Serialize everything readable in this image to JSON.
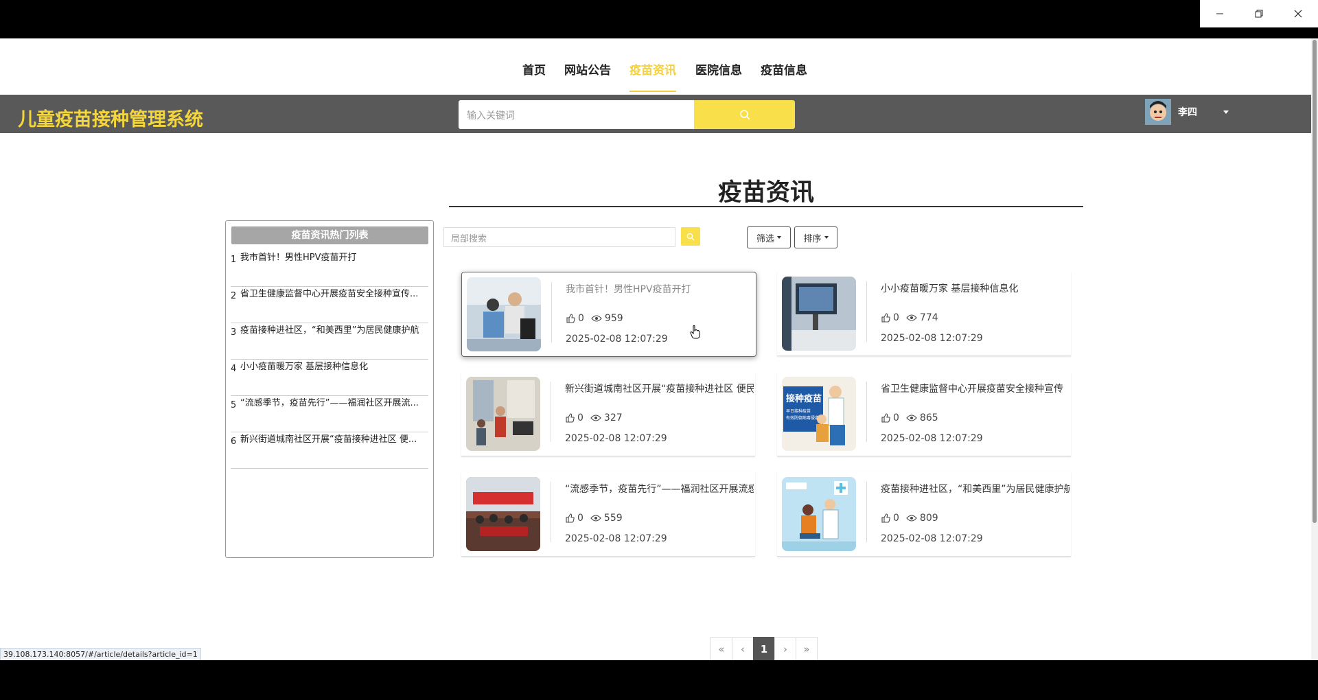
{
  "nav": {
    "items": [
      {
        "label": "首页"
      },
      {
        "label": "网站公告"
      },
      {
        "label": "疫苗资讯"
      },
      {
        "label": "医院信息"
      },
      {
        "label": "疫苗信息"
      }
    ],
    "active": "疫苗资讯"
  },
  "header": {
    "brand": "儿童疫苗接种管理系统",
    "search_placeholder": "输入关键词",
    "user_name": "李四"
  },
  "page": {
    "title": "疫苗资讯",
    "local_search_placeholder": "局部搜索",
    "filter_label": "筛选",
    "sort_label": "排序"
  },
  "hotlist": {
    "heading": "疫苗资讯热门列表",
    "items": [
      {
        "rank": "1",
        "title": "我市首针！男性HPV疫苗开打"
      },
      {
        "rank": "2",
        "title": "省卫生健康监督中心开展疫苗安全接种宣传..."
      },
      {
        "rank": "3",
        "title": "疫苗接种进社区，“和美西里”为居民健康护航"
      },
      {
        "rank": "4",
        "title": "小小疫苗暖万家 基层接种信息化"
      },
      {
        "rank": "5",
        "title": "“流感季节，疫苗先行”——福润社区开展流..."
      },
      {
        "rank": "6",
        "title": "新兴街道城南社区开展“疫苗接种进社区 便..."
      }
    ]
  },
  "articles": [
    {
      "title": "我市首针！男性HPV疫苗开打",
      "likes": "0",
      "views": "959",
      "date": "2025-02-08 12:07:29"
    },
    {
      "title": "小小疫苗暖万家 基层接种信息化",
      "likes": "0",
      "views": "774",
      "date": "2025-02-08 12:07:29"
    },
    {
      "title": "新兴街道城南社区开展“疫苗接种进社区 便民",
      "likes": "0",
      "views": "327",
      "date": "2025-02-08 12:07:29"
    },
    {
      "title": "省卫生健康监督中心开展疫苗安全接种宣传",
      "likes": "0",
      "views": "865",
      "date": "2025-02-08 12:07:29",
      "thumb_text_1": "接种疫苗",
      "thumb_text_2": "早日接种疫苗",
      "thumb_text_3": "有效防御病毒侵袭"
    },
    {
      "title": "“流感季节，疫苗先行”——福润社区开展流感",
      "likes": "0",
      "views": "559",
      "date": "2025-02-08 12:07:29"
    },
    {
      "title": "疫苗接种进社区，“和美西里”为居民健康护航",
      "likes": "0",
      "views": "809",
      "date": "2025-02-08 12:07:29"
    }
  ],
  "pagination": {
    "first": "«",
    "prev": "‹",
    "current": "1",
    "next": "›",
    "last": "»"
  },
  "status_url": "39.108.173.140:8057/#/article/details?article_id=1",
  "colors": {
    "accent": "#f4d03f",
    "band": "#595959",
    "search_button": "#f9e04b"
  }
}
